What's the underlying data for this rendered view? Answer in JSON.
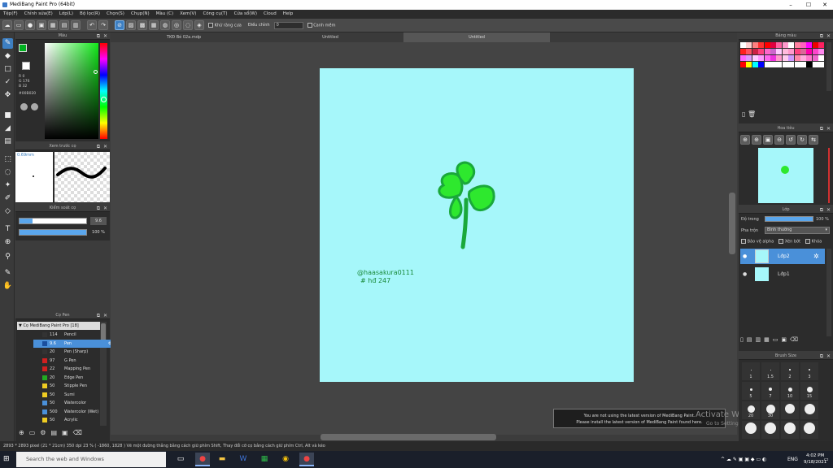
{
  "window": {
    "title": "MediBang Paint Pro (64bit)",
    "controls": [
      "–",
      "☐",
      "✕"
    ]
  },
  "menu": [
    "Tệp(F)",
    "Chỉnh sửa(E)",
    "Lớp(L)",
    "Bộ lọc(R)",
    "Chọn(S)",
    "Chụp(N)",
    "Màu (C)",
    "Xem(V)",
    "Công cụ(T)",
    "Cửa sổ(W)",
    "Cloud",
    "Help"
  ],
  "toolbar": {
    "antialias_label": "Khử răng cưa",
    "correction_label": "Điều chỉnh",
    "correction_value": "0",
    "clip_label": "Canh mềm"
  },
  "tabs": [
    "TKĐ Bé 02a.mdp",
    "Untitled",
    "Untitled"
  ],
  "color_panel": {
    "title": "Màu",
    "rgb": [
      "R 0",
      "G 176",
      "B 32"
    ],
    "hex": "#00B020"
  },
  "brush_preview": {
    "title": "Xem trước cọ",
    "size": "0.69mm"
  },
  "brush_control": {
    "title": "Kiểm soát cọ",
    "size_value": "9.6",
    "opacity_value": "100 %"
  },
  "brush_panel": {
    "title": "Cọ Pen",
    "group": "Cọ MediBang Paint Pro [18]",
    "items": [
      {
        "num": "114",
        "name": "Pencil",
        "color": "#333333"
      },
      {
        "num": "9.6",
        "name": "Pen",
        "color": "#1a4f9e",
        "selected": true
      },
      {
        "num": "20",
        "name": "Pen (Sharp)",
        "color": "#333333"
      },
      {
        "num": "97",
        "name": "G Pen",
        "color": "#d02020"
      },
      {
        "num": "22",
        "name": "Mapping Pen",
        "color": "#d02020"
      },
      {
        "num": "20",
        "name": "Edge Pen",
        "color": "#22aa22"
      },
      {
        "num": "50",
        "name": "Stipple Pen",
        "color": "#eecc22"
      },
      {
        "num": "50",
        "name": "Sumi",
        "color": "#eecc22"
      },
      {
        "num": "50",
        "name": "Watercolor",
        "color": "#4a90d9"
      },
      {
        "num": "500",
        "name": "Watercolor (Wet)",
        "color": "#4a90d9"
      },
      {
        "num": "50",
        "name": "Acrylic",
        "color": "#eecc22"
      }
    ]
  },
  "canvas": {
    "signature_line1": "@haasakura0111",
    "signature_line2": "# hđ 247",
    "leaf_color": "#2ee82e",
    "outline_color": "#1aa83a",
    "bg_color": "#a6f7fa"
  },
  "notice": {
    "line1": "You are not using the latest version of MediBang Paint.",
    "line2": "Please install the latest version of MediBang Paint found here."
  },
  "watermark": {
    "line1": "Activate Windows",
    "line2": "Go to Settings to activate Windows."
  },
  "statusbar": "2893 * 2893 pixel (21 * 21cm) 350 dpi 23 % ( -1860, 1828 ) Vẽ một đường thẳng bằng cách giữ phím Shift, Thay đổi cỡ cọ bằng cách giữ phím Ctrl, Alt và kéo",
  "right_panels": {
    "palette_title": "Bảng màu",
    "navigator_title": "Hoa tiêu",
    "layer_title": "Lớp",
    "opacity_label": "Độ trong",
    "opacity_value": "100 %",
    "blend_label": "Pha trộn",
    "blend_value": "Bình thường",
    "protect_alpha": "Bảo vệ alpha",
    "clipping": "Xén bớt",
    "lock": "Khóa",
    "layers": [
      {
        "name": "Lớp2",
        "selected": true
      },
      {
        "name": "Lớp1",
        "selected": false
      }
    ],
    "brush_size_title": "Brush Size",
    "brush_sizes": [
      "1",
      "1.5",
      "2",
      "3",
      "5",
      "7",
      "10",
      "15",
      "20",
      "30"
    ]
  },
  "taskbar": {
    "search_placeholder": "Search the web and Windows",
    "time": "4:02 PM",
    "date": "9/18/2021",
    "lang": "ENG"
  }
}
